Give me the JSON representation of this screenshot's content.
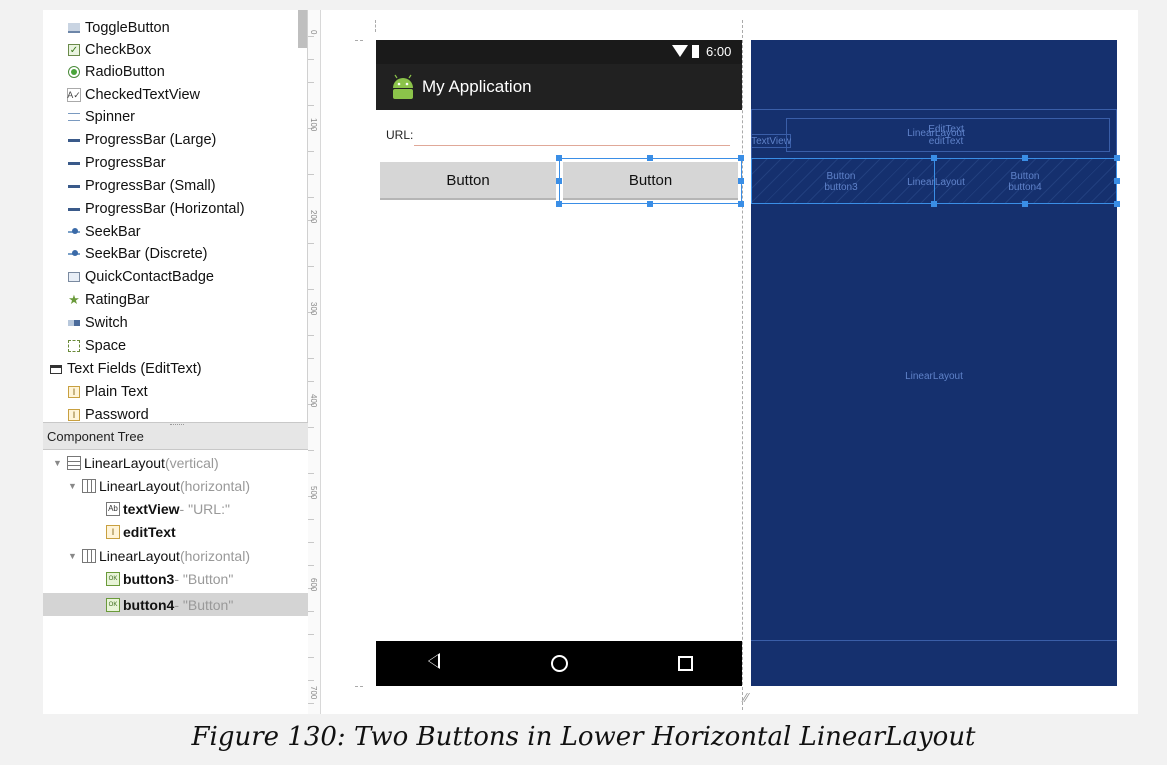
{
  "palette": {
    "items": [
      {
        "label": "ToggleButton",
        "icon": "toggle-button-icon"
      },
      {
        "label": "CheckBox",
        "icon": "checkbox-icon"
      },
      {
        "label": "RadioButton",
        "icon": "radio-button-icon"
      },
      {
        "label": "CheckedTextView",
        "icon": "checked-text-view-icon"
      },
      {
        "label": "Spinner",
        "icon": "spinner-icon"
      },
      {
        "label": "ProgressBar (Large)",
        "icon": "progress-bar-icon"
      },
      {
        "label": "ProgressBar",
        "icon": "progress-bar-icon"
      },
      {
        "label": "ProgressBar (Small)",
        "icon": "progress-bar-icon"
      },
      {
        "label": "ProgressBar (Horizontal)",
        "icon": "progress-bar-icon"
      },
      {
        "label": "SeekBar",
        "icon": "seekbar-icon"
      },
      {
        "label": "SeekBar (Discrete)",
        "icon": "seekbar-icon"
      },
      {
        "label": "QuickContactBadge",
        "icon": "contact-badge-icon"
      },
      {
        "label": "RatingBar",
        "icon": "star-icon"
      },
      {
        "label": "Switch",
        "icon": "switch-icon"
      },
      {
        "label": "Space",
        "icon": "space-icon"
      },
      {
        "label": "Text Fields (EditText)",
        "icon": "folder-icon"
      },
      {
        "label": "Plain Text",
        "icon": "text-field-icon"
      },
      {
        "label": "Password",
        "icon": "text-field-icon"
      }
    ]
  },
  "component_tree": {
    "header": "Component Tree",
    "rows": [
      {
        "name": "LinearLayout",
        "detail": "(vertical)"
      },
      {
        "name": "LinearLayout",
        "detail": "(horizontal)"
      },
      {
        "name": "textView",
        "detail": " - \"URL:\""
      },
      {
        "name": "editText",
        "detail": ""
      },
      {
        "name": "LinearLayout",
        "detail": "(horizontal)"
      },
      {
        "name": "button3",
        "detail": " - \"Button\""
      },
      {
        "name": "button4",
        "detail": " - \"Button\"",
        "selected": true
      }
    ]
  },
  "ruler": {
    "labels": [
      "0",
      "100",
      "200",
      "300",
      "400",
      "500",
      "600",
      "700"
    ]
  },
  "device": {
    "status_time": "6:00",
    "app_title": "My Application",
    "url_label": "URL:",
    "button_left": "Button",
    "button_right": "Button"
  },
  "blueprint": {
    "textview": "TextView",
    "linearlayout_top": "LinearLayout",
    "edittext": "EditText",
    "edittext_id": "editText",
    "button3_label": "Button",
    "button3_id": "button3",
    "linearlayout_mid": "LinearLayout",
    "button4_label": "Button",
    "button4_id": "button4",
    "linearlayout_root": "LinearLayout"
  },
  "caption": "Figure 130: Two Buttons in Lower Horizontal LinearLayout",
  "colors": {
    "accent": "#3a8ee6",
    "blueprint": "#15306e",
    "android_green": "#8bc34a"
  }
}
